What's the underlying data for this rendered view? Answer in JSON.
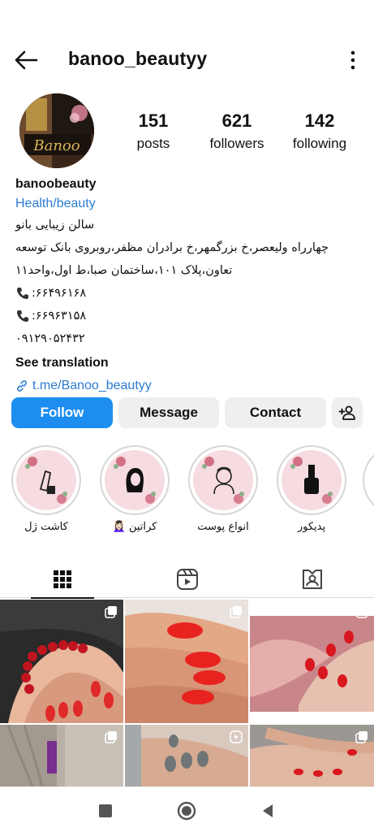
{
  "header": {
    "username": "banoo_beautyy",
    "back_icon": "arrow-left-icon",
    "more_icon": "more-vertical-icon"
  },
  "profile": {
    "avatar_text": "Banoo",
    "stats": [
      {
        "value": "151",
        "label": "posts"
      },
      {
        "value": "621",
        "label": "followers"
      },
      {
        "value": "142",
        "label": "following"
      }
    ]
  },
  "bio": {
    "name": "banoobeauty",
    "category": "Health/beauty",
    "line1": "سالن زیبایی بانو",
    "line2": "چهارراه ولیعصر،خ بزرگمهر،خ برادران مظفر،روبروی بانک توسعه",
    "line3": "تعاون،پلاک ۱۰۱،ساختمان صبا،ط اول،واحد۱۱",
    "phone1": ":۶۶۴۹۶۱۶۸",
    "phone2": ":۶۶۹۶۳۱۵۸",
    "mobile": "۰۹۱۲۹۰۵۲۴۳۲",
    "see_translation": "See translation",
    "link": "t.me/Banoo_beautyy"
  },
  "actions": {
    "follow": "Follow",
    "message": "Message",
    "contact": "Contact"
  },
  "highlights": [
    {
      "label": "کاشت ژل",
      "icon": "nail-polish-icon"
    },
    {
      "label": "کراتین 💆🏻‍♀️",
      "icon": "woman-hair-icon"
    },
    {
      "label": "انواع پوست",
      "icon": "face-skin-icon"
    },
    {
      "label": "پدیکور",
      "icon": "nail-bottle-icon"
    }
  ],
  "tabs": [
    "grid-icon",
    "reels-icon",
    "tagged-icon"
  ],
  "colors": {
    "accent": "#1d8ef0",
    "link": "#2b7bd1",
    "nail_red": "#e02a2a",
    "highlight_bg": "#f6dbe0"
  }
}
